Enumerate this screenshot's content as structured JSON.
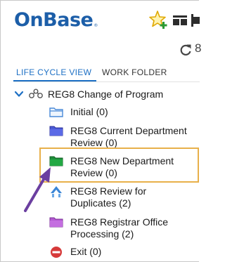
{
  "brand": {
    "name": "OnBase",
    "mark": "®"
  },
  "toolbar": {
    "icons": [
      "star-add-icon",
      "grid-view-icon",
      "more-icon",
      "refresh-icon"
    ],
    "cut_text": "8"
  },
  "tabs": [
    {
      "label": "LIFE CYCLE VIEW",
      "active": true
    },
    {
      "label": "WORK FOLDER",
      "active": false
    }
  ],
  "tree": {
    "root": {
      "label": "REG8 Change of Program",
      "expanded": true
    },
    "items": [
      {
        "lines": [
          "Initial (0)"
        ],
        "icon": "folder-outline-icon",
        "color": "#4a8ad8"
      },
      {
        "lines": [
          "REG8 Current Department",
          "Review (0)"
        ],
        "icon": "queue-blue-icon",
        "color": "#4b5bd6"
      },
      {
        "lines": [
          "REG8 New Department",
          "Review (0)"
        ],
        "icon": "queue-green-icon",
        "color": "#1e8f3a",
        "highlighted": true
      },
      {
        "lines": [
          "REG8 Review for",
          "Duplicates (2)"
        ],
        "icon": "queue-load-balance-icon",
        "color": "#3b86d6"
      },
      {
        "lines": [
          "REG8 Registrar Office",
          "Processing (2)"
        ],
        "icon": "queue-purple-icon",
        "color": "#b45ad2"
      },
      {
        "lines": [
          "Exit (0)"
        ],
        "icon": "exit-icon",
        "color": "#d63a3a"
      }
    ]
  },
  "colors": {
    "accent": "#1c6fc4",
    "highlight": "#e8b04a",
    "arrow": "#6b3fa0"
  }
}
